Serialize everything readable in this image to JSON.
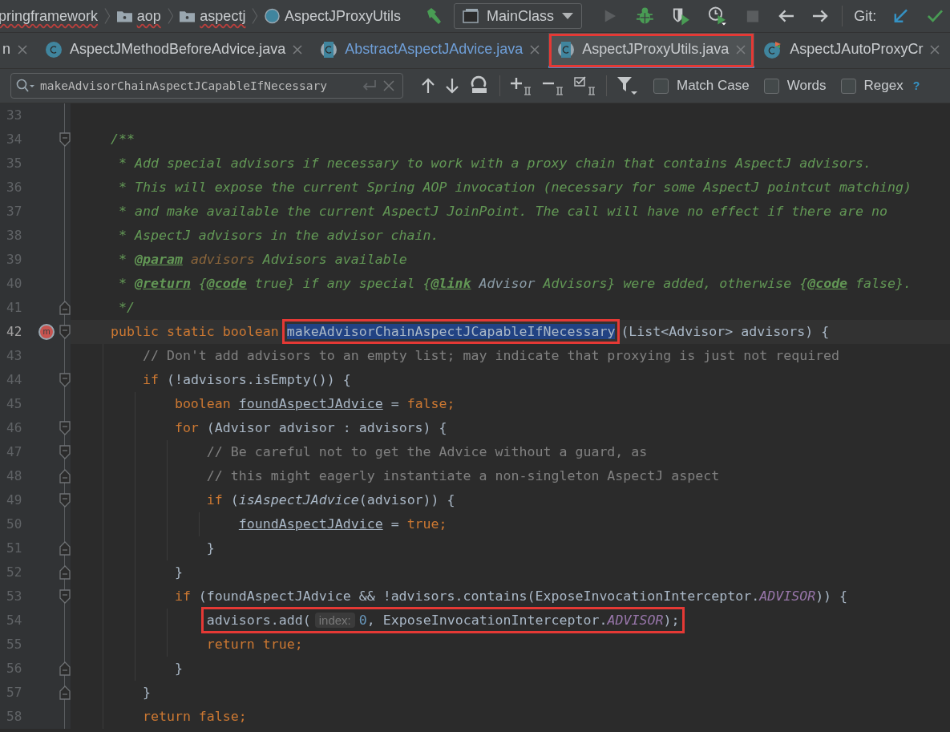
{
  "navbar": {
    "breadcrumbs": [
      {
        "label": "pringframework",
        "kind": "module"
      },
      {
        "label": "aop",
        "kind": "folder"
      },
      {
        "label": "aspectj",
        "kind": "folder"
      },
      {
        "label": "AspectJProxyUtils",
        "kind": "class"
      }
    ],
    "run_config": "MainClass",
    "actions": [
      {
        "kind": "build",
        "disabled": false
      },
      {
        "kind": "run",
        "disabled": true
      },
      {
        "kind": "debug",
        "disabled": false
      },
      {
        "kind": "coverage",
        "disabled": false
      },
      {
        "kind": "profile",
        "disabled": false
      },
      {
        "kind": "stop",
        "disabled": true
      },
      {
        "kind": "back",
        "disabled": false
      },
      {
        "kind": "forward",
        "disabled": false
      }
    ],
    "vcs_label": "Git:",
    "vcs_actions": [
      {
        "kind": "update"
      },
      {
        "kind": "commit"
      }
    ]
  },
  "tabs": [
    {
      "label": "n",
      "kind": "partial",
      "selected": false,
      "modified": false,
      "outlined": false
    },
    {
      "label": "AspectJMethodBeforeAdvice.java",
      "kind": "class",
      "selected": false,
      "modified": false,
      "outlined": false
    },
    {
      "label": "AbstractAspectJAdvice.java",
      "kind": "abstract",
      "selected": false,
      "modified": true,
      "outlined": false
    },
    {
      "label": "AspectJProxyUtils.java",
      "kind": "abstract",
      "selected": true,
      "modified": false,
      "outlined": true
    },
    {
      "label": "AspectJAutoProxyCr",
      "kind": "class-marked",
      "selected": false,
      "modified": false,
      "outlined": false
    }
  ],
  "search": {
    "value": "makeAdvisorChainAspectJCapableIfNecessary",
    "options": [
      {
        "label": "Match Case",
        "checked": false
      },
      {
        "label": "Words",
        "checked": false
      },
      {
        "label": "Regex",
        "checked": false
      }
    ],
    "help": "?"
  },
  "lines": [
    {
      "num": "33"
    },
    {
      "num": "34",
      "kind": "fold-start",
      "tokens": [
        {
          "kind": "doc",
          "text": "    /**"
        }
      ]
    },
    {
      "num": "35",
      "tokens": [
        {
          "kind": "doc",
          "text": "     * Add special advisors if necessary to work with a proxy chain that contains AspectJ advisors."
        }
      ]
    },
    {
      "num": "36",
      "tokens": [
        {
          "kind": "doc",
          "text": "     * This will expose the current Spring AOP invocation (necessary for some AspectJ pointcut matching)"
        }
      ]
    },
    {
      "num": "37",
      "tokens": [
        {
          "kind": "doc",
          "text": "     * and make available the current AspectJ JoinPoint. The call will have no effect if there are no"
        }
      ]
    },
    {
      "num": "38",
      "tokens": [
        {
          "kind": "doc",
          "text": "     * AspectJ advisors in the advisor chain."
        }
      ]
    },
    {
      "num": "39",
      "tokens": [
        {
          "kind": "doc",
          "text": "     * "
        },
        {
          "kind": "doc-tag",
          "text": "@param"
        },
        {
          "kind": "doc-param",
          "text": " advisors"
        },
        {
          "kind": "doc",
          "text": " Advisors available"
        }
      ]
    },
    {
      "num": "40",
      "tokens": [
        {
          "kind": "doc",
          "text": "     * "
        },
        {
          "kind": "doc-tag",
          "text": "@return"
        },
        {
          "kind": "doc",
          "text": " {"
        },
        {
          "kind": "doc-tag",
          "text": "@code"
        },
        {
          "kind": "doc",
          "text": " true} if any special {"
        },
        {
          "kind": "doc-tag",
          "text": "@link"
        },
        {
          "kind": "doc-ref",
          "text": " Advisor"
        },
        {
          "kind": "doc",
          "text": " Advisors} were added, otherwise {"
        },
        {
          "kind": "doc-tag",
          "text": "@code"
        },
        {
          "kind": "doc",
          "text": " false}."
        }
      ]
    },
    {
      "num": "41",
      "kind": "fold-end",
      "tokens": [
        {
          "kind": "doc",
          "text": "     */"
        }
      ]
    },
    {
      "num": "42",
      "kind": "fold-start",
      "current": true,
      "marker": "m",
      "tokens": [
        {
          "kind": "keyword",
          "text": "    public static boolean "
        },
        {
          "kind": "match",
          "text": "makeAdvisorChainAspectJCapableIfNecessary",
          "outlined": true
        },
        {
          "kind": "plain",
          "text": "(List<Advisor> advisors) {"
        }
      ]
    },
    {
      "num": "43",
      "tokens": [
        {
          "kind": "comment",
          "text": "        // Don't add advisors to an empty list; may indicate that proxying is just not required"
        }
      ]
    },
    {
      "num": "44",
      "kind": "fold-start",
      "tokens": [
        {
          "kind": "keyword",
          "text": "        if"
        },
        {
          "kind": "plain",
          "text": " (!advisors.isEmpty()) {"
        }
      ]
    },
    {
      "num": "45",
      "tokens": [
        {
          "kind": "keyword",
          "text": "            boolean "
        },
        {
          "kind": "variable",
          "text": "foundAspectJAdvice"
        },
        {
          "kind": "plain",
          "text": " = "
        },
        {
          "kind": "keyword",
          "text": "false;"
        }
      ]
    },
    {
      "num": "46",
      "kind": "fold-start",
      "tokens": [
        {
          "kind": "keyword",
          "text": "            for"
        },
        {
          "kind": "plain",
          "text": " (Advisor advisor : advisors) {"
        }
      ]
    },
    {
      "num": "47",
      "kind": "fold-start",
      "tokens": [
        {
          "kind": "comment",
          "text": "                // Be careful not to get the Advice without a guard, as"
        }
      ]
    },
    {
      "num": "48",
      "kind": "fold-end",
      "tokens": [
        {
          "kind": "comment",
          "text": "                // this might eagerly instantiate a non-singleton AspectJ aspect"
        }
      ]
    },
    {
      "num": "49",
      "kind": "fold-start",
      "tokens": [
        {
          "kind": "keyword",
          "text": "                if"
        },
        {
          "kind": "plain",
          "text": " ("
        },
        {
          "kind": "call",
          "text": "isAspectJAdvice"
        },
        {
          "kind": "plain",
          "text": "(advisor)) {"
        }
      ]
    },
    {
      "num": "50",
      "tokens": [
        {
          "kind": "variable",
          "text": "                    foundAspectJAdvice"
        },
        {
          "kind": "plain",
          "text": " = "
        },
        {
          "kind": "keyword",
          "text": "true;"
        }
      ]
    },
    {
      "num": "51",
      "kind": "fold-end",
      "tokens": [
        {
          "kind": "plain",
          "text": "                }"
        }
      ]
    },
    {
      "num": "52",
      "kind": "fold-end",
      "tokens": [
        {
          "kind": "plain",
          "text": "            }"
        }
      ]
    },
    {
      "num": "53",
      "kind": "fold-start",
      "tokens": [
        {
          "kind": "keyword",
          "text": "            if"
        },
        {
          "kind": "plain",
          "text": " (foundAspectJAdvice && !advisors.contains(ExposeInvocationInterceptor."
        },
        {
          "kind": "constant",
          "text": "ADVISOR"
        },
        {
          "kind": "plain",
          "text": ")) {"
        }
      ]
    },
    {
      "num": "54",
      "outlined": true,
      "tokens": [
        {
          "kind": "plain",
          "text": "                advisors.add("
        },
        {
          "kind": "hint",
          "text": "index:"
        },
        {
          "kind": "number",
          "text": "0"
        },
        {
          "kind": "plain",
          "text": ", ExposeInvocationInterceptor."
        },
        {
          "kind": "constant",
          "text": "ADVISOR"
        },
        {
          "kind": "plain",
          "text": ");"
        }
      ]
    },
    {
      "num": "55",
      "tokens": [
        {
          "kind": "keyword",
          "text": "                return true;"
        }
      ]
    },
    {
      "num": "56",
      "kind": "fold-end",
      "tokens": [
        {
          "kind": "plain",
          "text": "            }"
        }
      ]
    },
    {
      "num": "57",
      "kind": "fold-end",
      "tokens": [
        {
          "kind": "plain",
          "text": "        }"
        }
      ]
    },
    {
      "num": "58",
      "tokens": [
        {
          "kind": "keyword",
          "text": "        return false;"
        }
      ]
    }
  ]
}
